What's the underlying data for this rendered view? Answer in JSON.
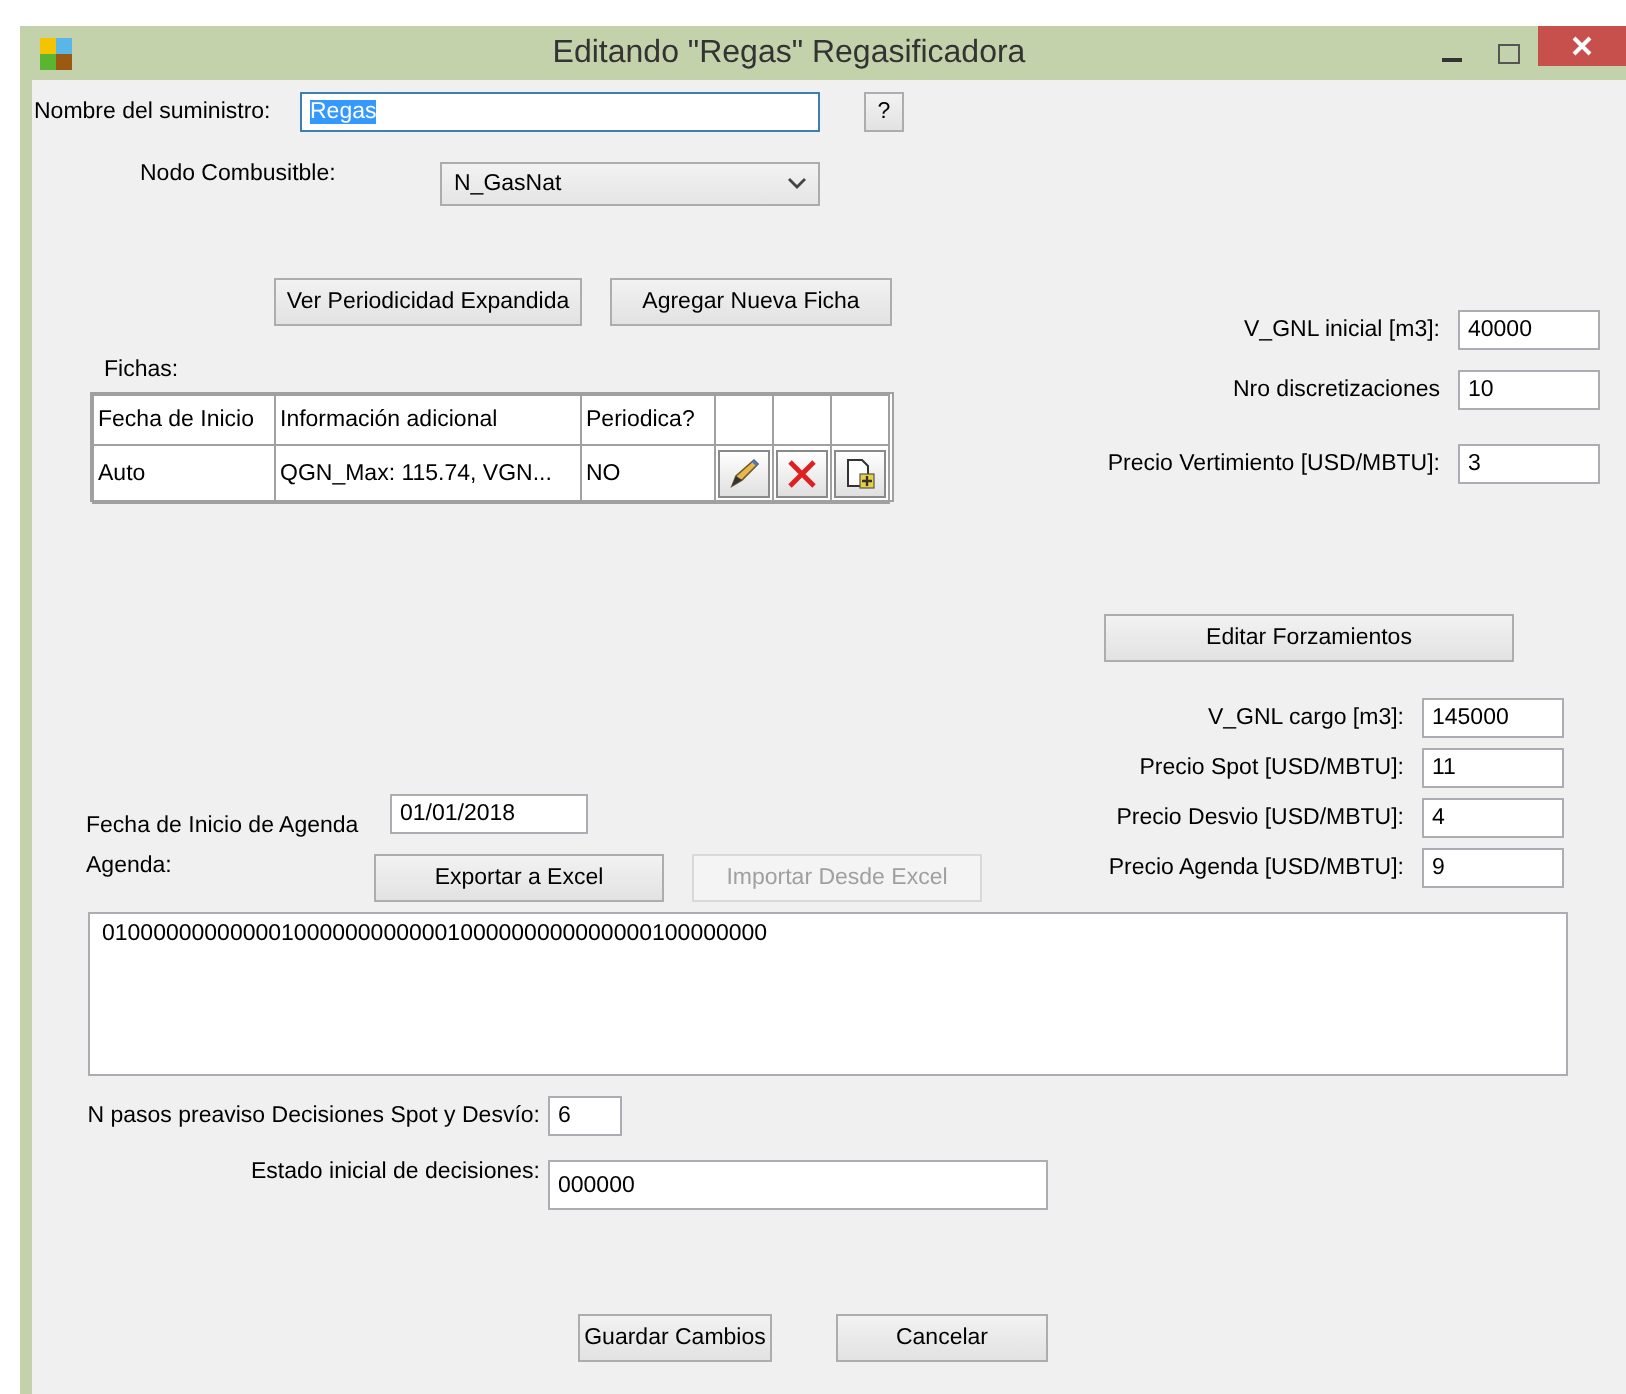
{
  "window": {
    "title": "Editando \"Regas\" Regasificadora"
  },
  "nombre": {
    "label": "Nombre del suministro:",
    "value": "Regas",
    "text_selected": true
  },
  "help_button": "?",
  "nodo": {
    "label": "Nodo Combusitble:",
    "value": "N_GasNat"
  },
  "top_buttons": [
    "Ver Periodicidad Expandida",
    "Agregar Nueva Ficha"
  ],
  "fichas": {
    "label": "Fichas:",
    "columns": [
      "Fecha de Inicio",
      "Información adicional",
      "Periodica?"
    ],
    "rows": [
      {
        "cells": [
          "Auto",
          "QGN_Max: 115.74, VGN...",
          "NO"
        ]
      }
    ]
  },
  "right_fields_1": [
    {
      "label": "V_GNL inicial [m3]:",
      "value": "40000"
    },
    {
      "label": "Nro discretizaciones",
      "value": "10"
    },
    {
      "label": "Precio Vertimiento [USD/MBTU]:",
      "value": "3"
    }
  ],
  "forzamientos_button": "Editar Forzamientos",
  "right_fields_2": [
    {
      "label": "V_GNL cargo [m3]:",
      "value": "145000"
    },
    {
      "label": "Precio Spot [USD/MBTU]:",
      "value": "11"
    },
    {
      "label": "Precio Desvio [USD/MBTU]:",
      "value": "4"
    },
    {
      "label": "Precio Agenda [USD/MBTU]:",
      "value": "9"
    }
  ],
  "agenda": {
    "start_label": "Fecha de Inicio de Agenda",
    "start_value": "01/01/2018",
    "label": "Agenda:",
    "buttons": [
      {
        "label": "Exportar a Excel",
        "disabled": false
      },
      {
        "label": "Importar Desde Excel",
        "disabled": true
      }
    ],
    "text": "0100000000000010000000000001000000000000000100000000"
  },
  "preaviso": {
    "label": "N pasos preaviso Decisiones Spot y Desvío:",
    "value": "6"
  },
  "estado_inicial": {
    "label": "Estado inicial de decisiones:",
    "value": "000000"
  },
  "buttons": [
    "Guardar Cambios",
    "Cancelar"
  ]
}
